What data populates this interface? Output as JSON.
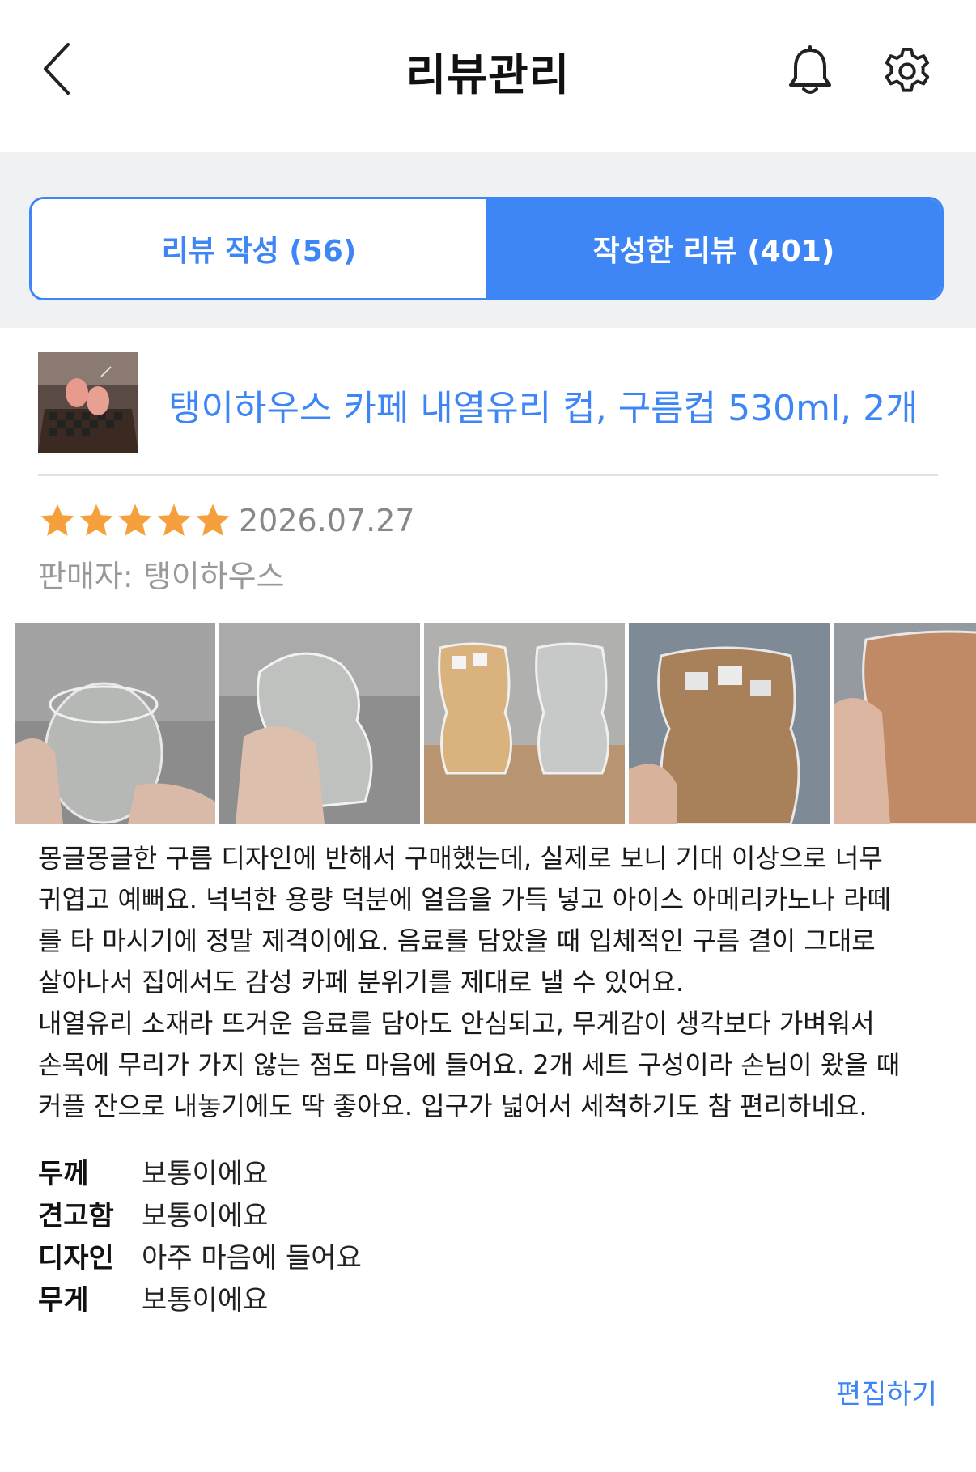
{
  "header": {
    "title": "리뷰관리",
    "back_icon": "chevron-left-icon",
    "bell_icon": "bell-icon",
    "settings_icon": "gear-icon"
  },
  "tabs": [
    {
      "label": "리뷰 작성 (56)",
      "active": false
    },
    {
      "label": "작성한 리뷰 (401)",
      "active": true
    }
  ],
  "product": {
    "name": "탱이하우스 카페 내열유리 컵, 구름컵 530ml, 2개"
  },
  "review": {
    "rating": 5,
    "rating_max": 5,
    "date": "2026.07.27",
    "seller": "판매자: 탱이하우스",
    "photo_count_visible": 5,
    "lines": [
      "몽글몽글한 구름 디자인에 반해서 구매했는데, 실제로 보니 기대 이상으로 너무",
      "귀엽고 예뻐요. 넉넉한 용량 덕분에 얼음을 가득 넣고 아이스 아메리카노나 라떼",
      "를 타 마시기에 정말 제격이에요. 음료를 담았을 때 입체적인 구름 결이 그대로",
      "살아나서 집에서도 감성 카페 분위기를 제대로 낼 수 있어요.",
      "내열유리 소재라 뜨거운 음료를 담아도 안심되고, 무게감이 생각보다 가벼워서",
      "손목에 무리가 가지 않는 점도 마음에 들어요. 2개 세트 구성이라 손님이 왔을 때",
      "커플 잔으로 내놓기에도 딱 좋아요. 입구가 넓어서 세척하기도 참 편리하네요."
    ],
    "attributes": [
      {
        "key": "두께",
        "value": "보통이에요"
      },
      {
        "key": "견고함",
        "value": "보통이에요"
      },
      {
        "key": "디자인",
        "value": "아주 마음에 들어요"
      },
      {
        "key": "무게",
        "value": "보통이에요"
      }
    ],
    "edit_label": "편집하기"
  },
  "colors": {
    "accent": "#3e86f5",
    "star": "#f5a03c",
    "band": "#f0f1f3"
  }
}
